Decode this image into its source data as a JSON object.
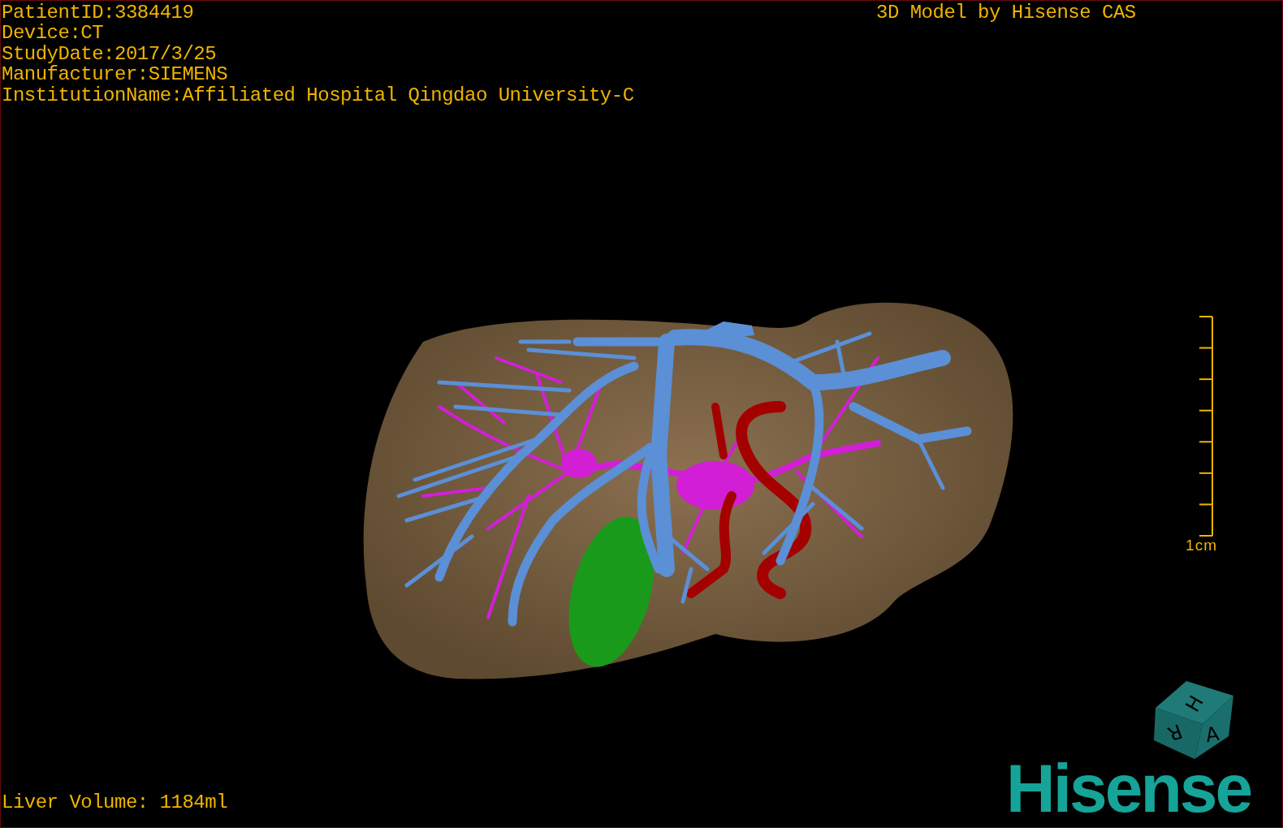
{
  "study_info": [
    "PatientID:3384419",
    "Device:CT",
    "StudyDate:2017/3/25",
    "Manufacturer:SIEMENS",
    "InstitutionName:Affiliated Hospital Qingdao University-C"
  ],
  "title": "3D Model by Hisense CAS",
  "scale_bar": {
    "label": "1cm"
  },
  "orientation_cube": {
    "faces": [
      "H",
      "R",
      "A"
    ]
  },
  "liver_volume": "Liver Volume: 1184ml",
  "logo": "Hisense"
}
